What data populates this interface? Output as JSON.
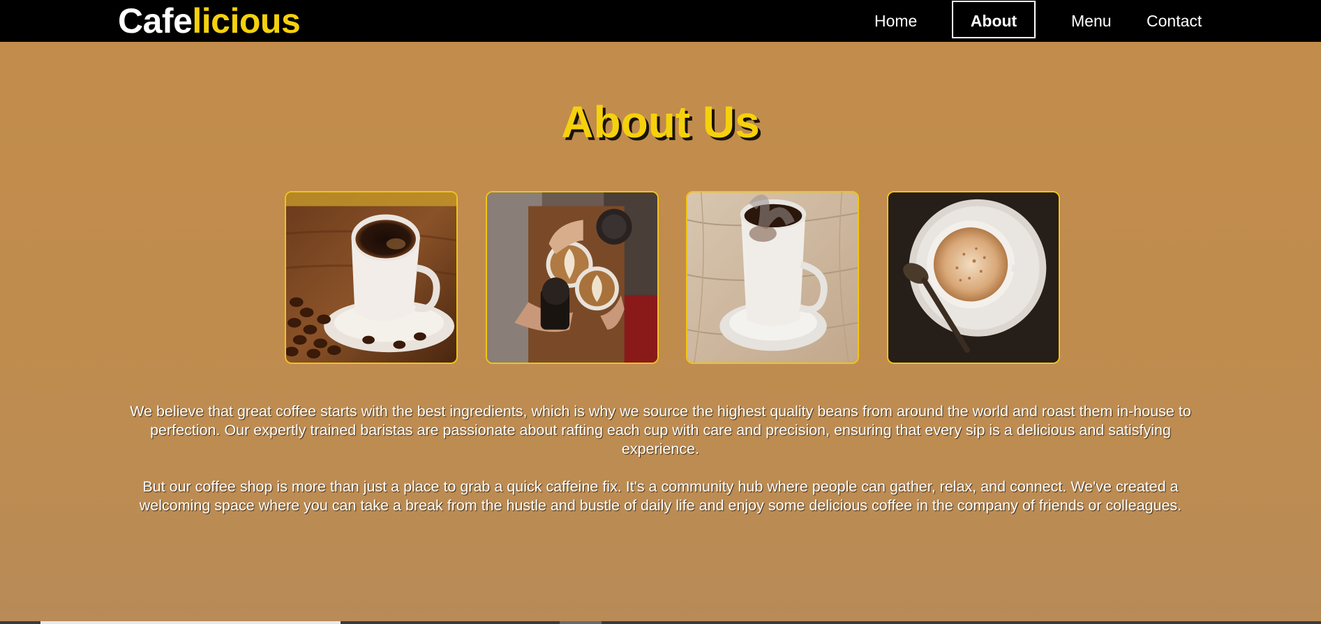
{
  "brand": {
    "part1": "Cafe",
    "part2": "licious"
  },
  "nav": {
    "home": "Home",
    "about": "About",
    "menu": "Menu",
    "contact": "Contact",
    "active": "About"
  },
  "heading": "About Us",
  "gallery": [
    {
      "icon": "coffee-cup-with-beans-image"
    },
    {
      "icon": "latte-art-cheers-image"
    },
    {
      "icon": "steaming-coffee-cup-image"
    },
    {
      "icon": "cappuccino-top-view-image"
    }
  ],
  "paragraphs": [
    "We believe that great coffee starts with the best ingredients, which is why we source the highest quality beans from around the world and roast them in-house to perfection. Our expertly trained baristas are passionate about rafting each cup with care and precision, ensuring that every sip is a delicious and satisfying experience.",
    "But our coffee shop is more than just a place to grab a quick caffeine fix. It's a community hub where people can gather, relax, and connect. We've created a welcoming space where you can take a break from the hustle and bustle of daily life and enjoy some delicious coffee in the company of friends or colleagues."
  ],
  "colors": {
    "background": "#c18c4c",
    "nav": "#000000",
    "accent": "#f5d10d",
    "text": "#ffffff"
  }
}
